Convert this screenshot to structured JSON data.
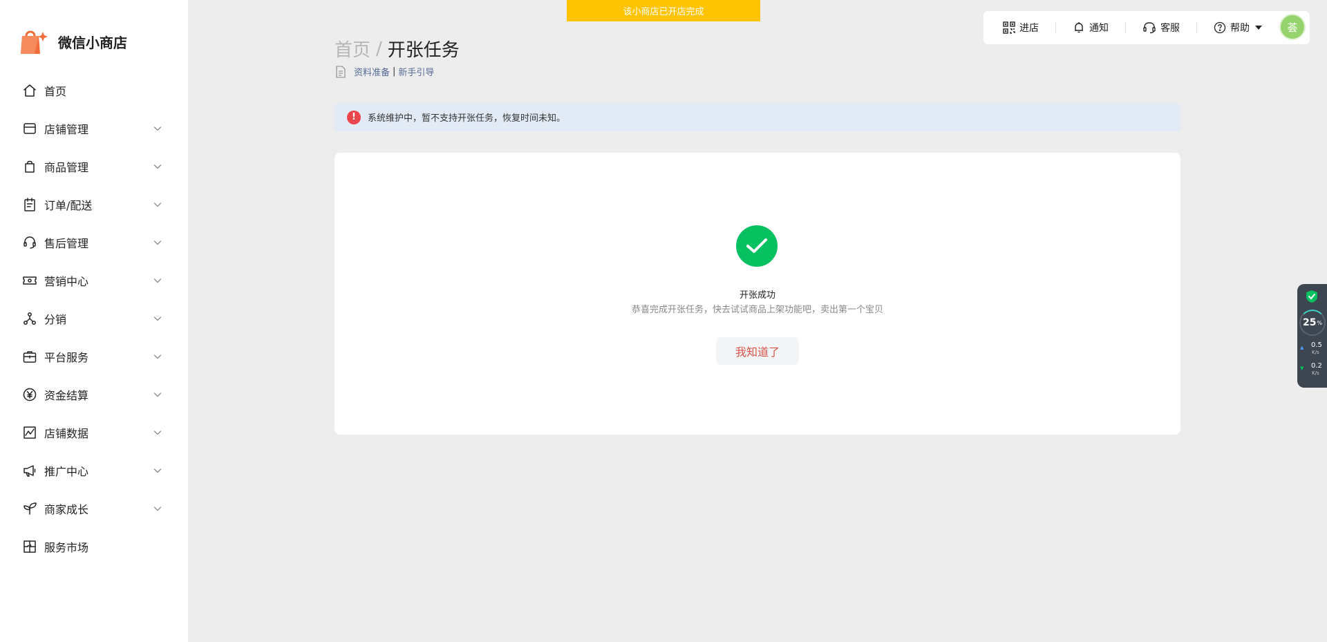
{
  "app": {
    "name": "微信小商店"
  },
  "banner": {
    "text": "该小商店已开店完成"
  },
  "sidebar": {
    "items": [
      {
        "label": "首页",
        "icon": "home-icon",
        "expandable": false
      },
      {
        "label": "店铺管理",
        "icon": "store-icon",
        "expandable": true
      },
      {
        "label": "商品管理",
        "icon": "bag-icon",
        "expandable": true
      },
      {
        "label": "订单/配送",
        "icon": "clipboard-icon",
        "expandable": true
      },
      {
        "label": "售后管理",
        "icon": "headset-icon",
        "expandable": true
      },
      {
        "label": "营销中心",
        "icon": "ticket-icon",
        "expandable": true
      },
      {
        "label": "分销",
        "icon": "share-nodes-icon",
        "expandable": true
      },
      {
        "label": "平台服务",
        "icon": "briefcase-icon",
        "expandable": true
      },
      {
        "label": "资金结算",
        "icon": "yen-icon",
        "expandable": true
      },
      {
        "label": "店铺数据",
        "icon": "chart-icon",
        "expandable": true
      },
      {
        "label": "推广中心",
        "icon": "megaphone-icon",
        "expandable": true
      },
      {
        "label": "商家成长",
        "icon": "sprout-icon",
        "expandable": true
      },
      {
        "label": "服务市场",
        "icon": "puzzle-icon",
        "expandable": false
      }
    ]
  },
  "toolbar": {
    "enter_store": "进店",
    "notify": "通知",
    "service": "客服",
    "help": "帮助",
    "avatar_text": "荟"
  },
  "breadcrumb": {
    "home": "首页",
    "separator": "/",
    "current": "开张任务"
  },
  "subnav": {
    "link1": "资料准备",
    "separator": "|",
    "link2": "新手引导"
  },
  "alert": {
    "icon": "!",
    "text": "系统维护中，暂不支持开张任务，恢复时间未知。"
  },
  "result": {
    "title": "开张成功",
    "description": "恭喜完成开张任务，快去试试商品上架功能吧，卖出第一个宝贝",
    "button": "我知道了"
  },
  "widget": {
    "percent": "25",
    "percent_unit": "%",
    "upload": "0.5",
    "download": "0.2",
    "unit": "K/s"
  },
  "colors": {
    "accent_green": "#07c160",
    "banner_yellow": "#ffc300",
    "alert_red": "#e9454a",
    "button_text": "#d9534a"
  }
}
